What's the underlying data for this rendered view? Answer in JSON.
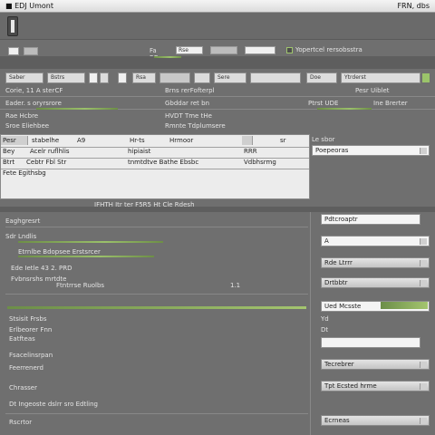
{
  "window": {
    "title": "■ EDJ Umont",
    "right_title": "FRN, dbs"
  },
  "toolbar": {
    "tab_a": "Fa RB",
    "tab_b": "Rse",
    "checkbox_label": "Yopertcel rersobsstra"
  },
  "form_header": {
    "cells": [
      "Saber",
      "Bstrs",
      "Rsa",
      "Sere"
    ],
    "right_cells": [
      "Doe",
      "Ytrderst"
    ]
  },
  "form_left": [
    "Corie, 11 A sterCF",
    "Eader. s oryrsrore",
    "Rae Hcbre",
    "Sroe Eliehbee"
  ],
  "form_mid": [
    "Brns rerFofterpl",
    "Gbddar ret bn",
    "HVDT Tme tHe",
    "Rmnte Tdplumsere"
  ],
  "form_right": [
    "Pesr Uiblet",
    "Ptrst UDE",
    "Ine Brerter"
  ],
  "table": {
    "headers": [
      "Pesr",
      "stabelhe",
      "A9",
      "Hr-ts",
      "Hrmoor",
      "",
      "sr"
    ],
    "rows": [
      [
        "Bey",
        "Acelr ruflhlis",
        "hipiaist",
        "RRR"
      ],
      [
        "Btrt",
        "Cebtr Fbl Str",
        "tnmtdtve Bathe Ebsbc",
        "Vdbhsrmg"
      ],
      [
        "Fete Egithsbg",
        "",
        "",
        ""
      ]
    ],
    "footer": "IFHTH Itr ter F5R5 Ht Cle Rdesh",
    "side_label": "Le sbor",
    "side_field": "Poepeoras"
  },
  "settings_left": [
    "Eaghgresrt",
    "Sdr Lndlis",
    "Etrnlbe Bdopsee Erstsrcer",
    "Ede Ietle 43 2. PRD",
    "Fvbnsrshs mrtdte",
    "Ftntrrse Ruolbs",
    "Stsisit Frsbs",
    "Erlbeorer Fnn",
    "Fsacelinsrpan",
    "Feerrenerd",
    "Chrasser",
    "Dt Ingeoste dslrr sro Edtling"
  ],
  "settings_right": {
    "field_1": "Pdtcroaptr",
    "field_2": "A",
    "button_1": "Rde Ltrrr",
    "button_2": "Drtbbtr",
    "field_3": "Ued Mcsste",
    "label_1": "Yd",
    "label_2": "Dt",
    "button_3": "Tecrebrer",
    "button_4": "Tpt Ecsted hrme",
    "button_5": "Ecrneas"
  },
  "misc": {
    "small_num": "1.1",
    "t1": "Eatfteas",
    "t2": "Rscrtor"
  }
}
